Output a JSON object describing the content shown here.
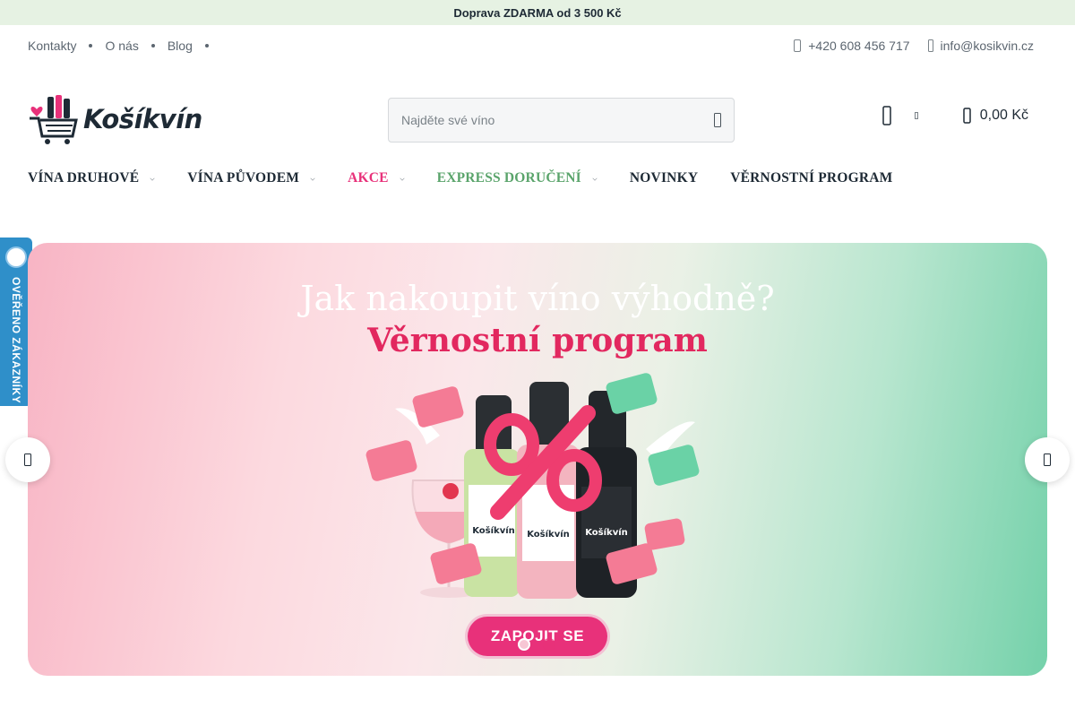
{
  "promo": {
    "text": "Doprava ZDARMA od 3 500 Kč"
  },
  "top_links": [
    {
      "label": "Kontakty"
    },
    {
      "label": "O nás"
    },
    {
      "label": "Blog"
    }
  ],
  "contacts": {
    "phone": "+420 608 456 717",
    "email": "info@kosikvin.cz"
  },
  "logo": {
    "text": "Košíkvín"
  },
  "search": {
    "placeholder": "Najděte své víno"
  },
  "cart": {
    "total": "0,00 Kč"
  },
  "nav": [
    {
      "label": "VÍNA DRUHOVÉ"
    },
    {
      "label": "VÍNA PŮVODEM"
    },
    {
      "label": "AKCE"
    },
    {
      "label": "EXPRESS DORUČENÍ"
    },
    {
      "label": "NOVINKY"
    },
    {
      "label": "VĚRNOSTNÍ PROGRAM"
    }
  ],
  "verified_badge": {
    "text": "OVĚŘENO ZÁKAZNÍKY"
  },
  "hero": {
    "title": "Jak nakoupit víno výhodně?",
    "subtitle": "Věrnostní program",
    "cta": "ZAPOJIT SE",
    "bottle_label": "Košíkvín",
    "slides_total": 2,
    "active_slide": 1
  },
  "colors": {
    "accent_pink": "#e8317a",
    "accent_green": "#5aa46b",
    "promo_bg": "#e6f2e3",
    "verified_blue": "#2f8fc9"
  },
  "icons": [
    "phone-icon",
    "email-icon",
    "search-icon",
    "user-icon",
    "cart-icon",
    "chevron-left-icon",
    "chevron-right-icon"
  ]
}
